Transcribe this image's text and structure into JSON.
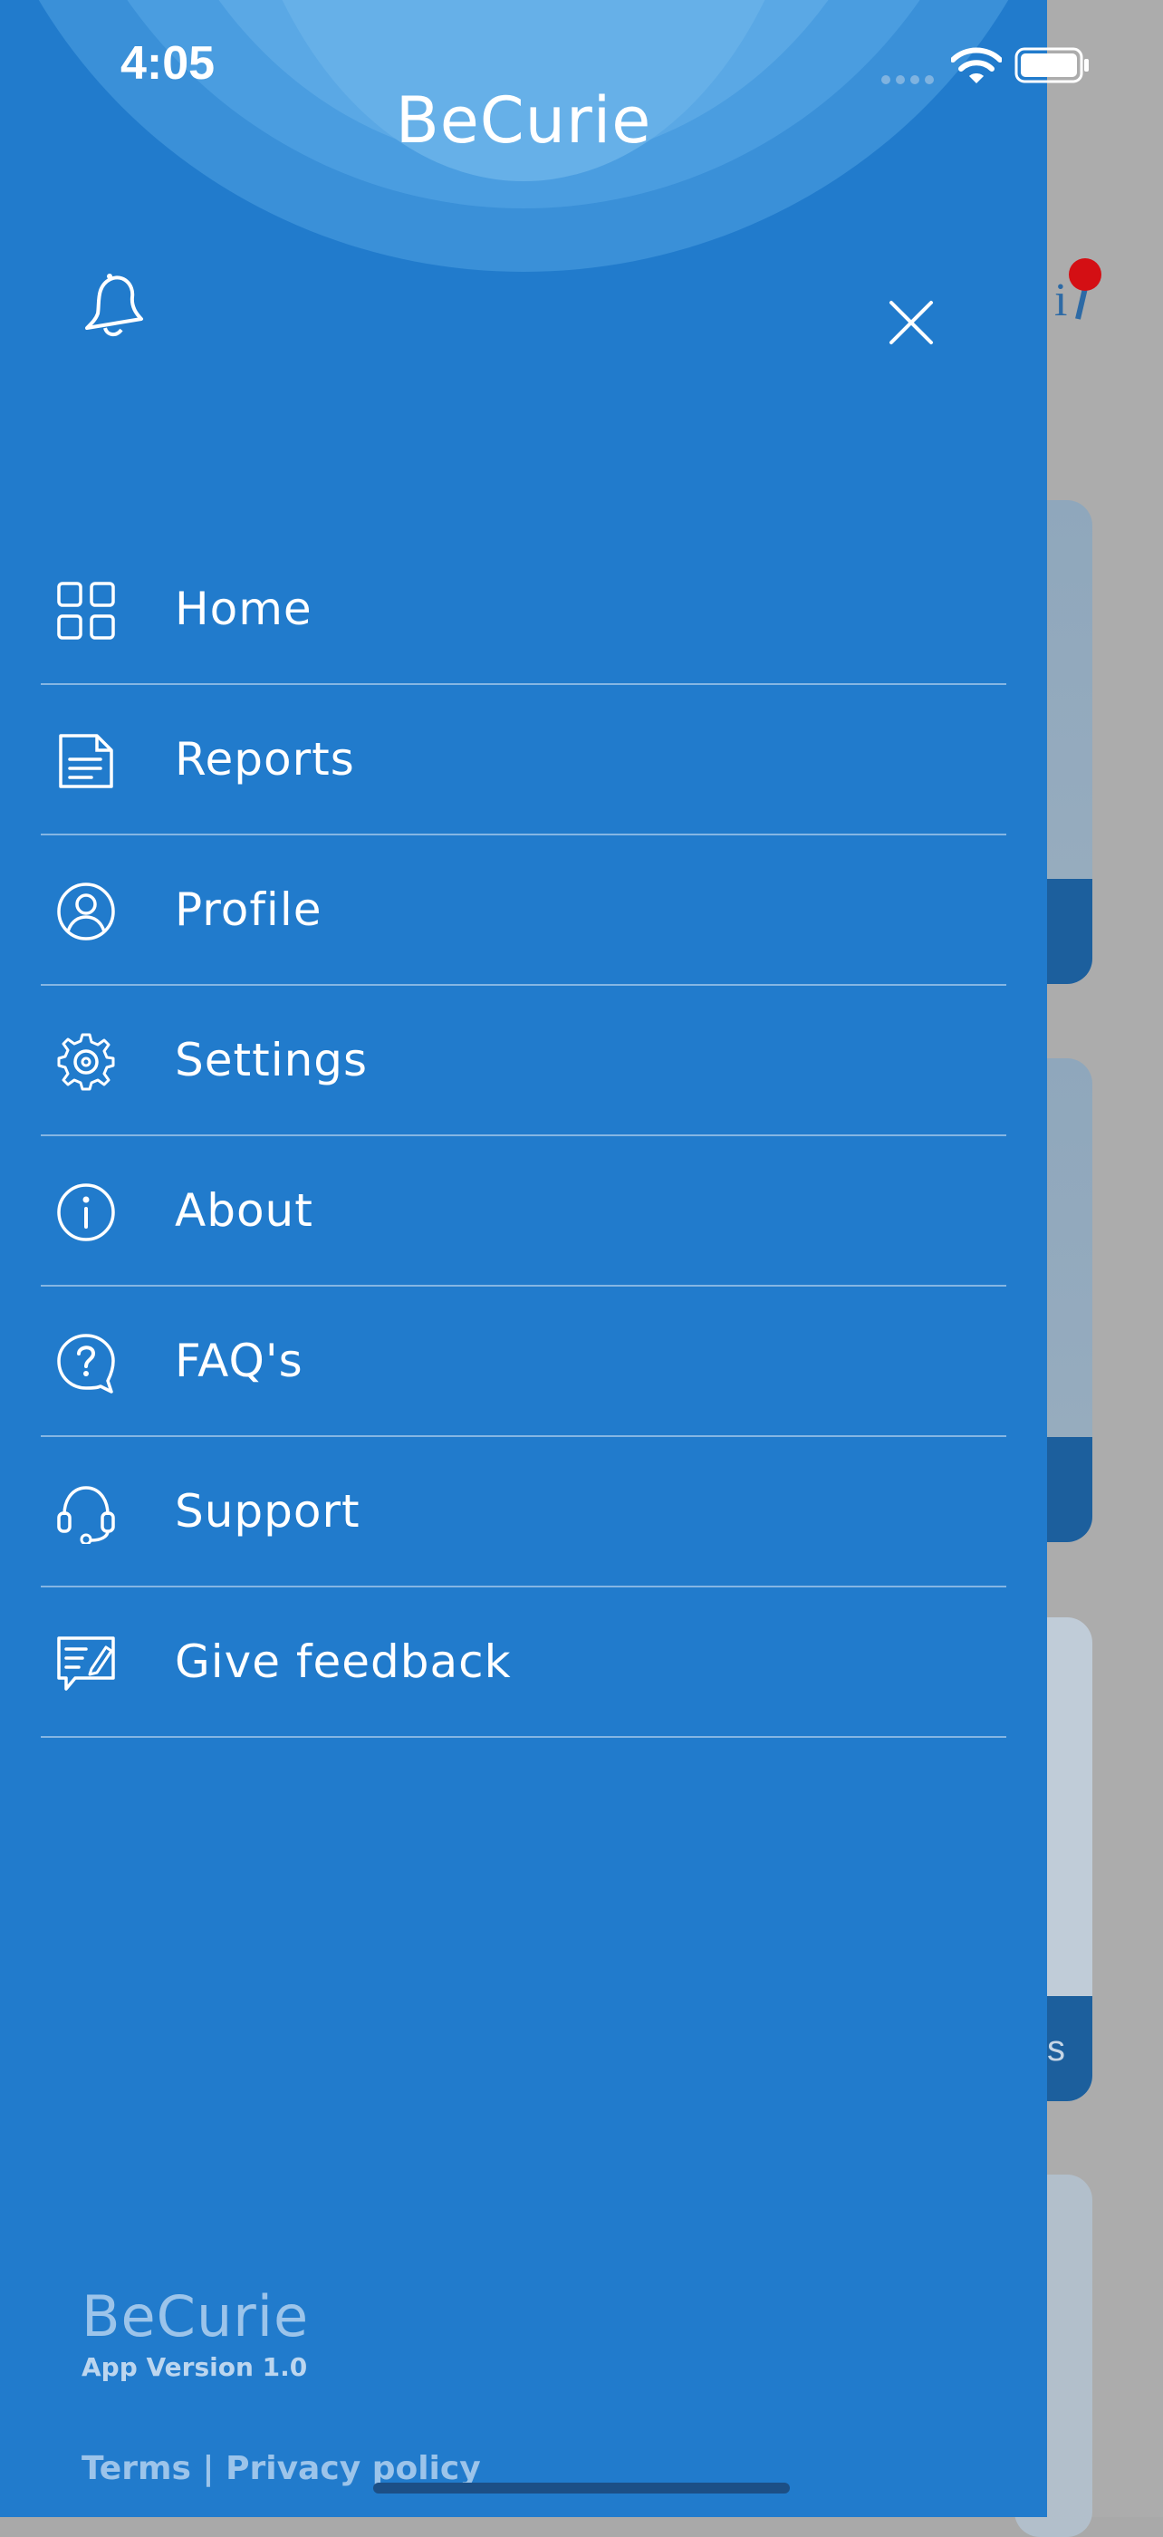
{
  "status_bar": {
    "time": "4:05"
  },
  "drawer": {
    "title": "BeCurie",
    "menu": [
      {
        "label": "Home",
        "icon": "grid-icon"
      },
      {
        "label": "Reports",
        "icon": "document-icon"
      },
      {
        "label": "Profile",
        "icon": "user-circle-icon"
      },
      {
        "label": "Settings",
        "icon": "gear-icon"
      },
      {
        "label": "About",
        "icon": "info-icon"
      },
      {
        "label": "FAQ's",
        "icon": "question-bubble-icon"
      },
      {
        "label": "Support",
        "icon": "headset-icon"
      },
      {
        "label": "Give feedback",
        "icon": "feedback-icon"
      }
    ],
    "footer": {
      "brand": "BeCurie",
      "version": "App Version 1.0",
      "terms": "Terms",
      "separator": " | ",
      "privacy": "Privacy policy"
    }
  },
  "background": {
    "card_text": "s"
  },
  "colors": {
    "drawer_bg": "#217bcc",
    "overlay": "#acacac",
    "notification_dot": "#d40f14"
  }
}
